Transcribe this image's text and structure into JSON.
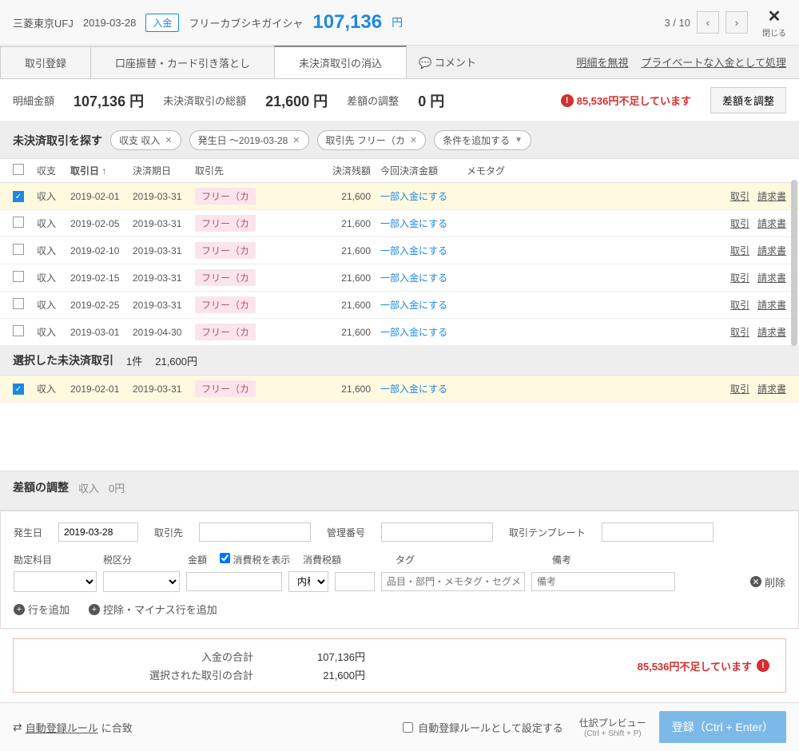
{
  "header": {
    "bank": "三菱東京UFJ",
    "date": "2019-03-28",
    "deposit_badge": "入金",
    "payer": "フリーカブシキガイシャ",
    "amount": "107,136",
    "yen": "円",
    "page": "3 / 10",
    "close": "閉じる"
  },
  "tabs": {
    "register": "取引登録",
    "transfer": "口座振替・カード引き落とし",
    "unsettled": "未決済取引の消込",
    "comment": "コメント"
  },
  "header_links": {
    "ignore": "明細を無視",
    "private": "プライベートな入金として処理"
  },
  "summary": {
    "detail_label": "明細金額",
    "detail_value": "107,136 円",
    "unsettled_label": "未決済取引の総額",
    "unsettled_value": "21,600 円",
    "diff_label": "差額の調整",
    "diff_value": "0 円",
    "shortage": "85,536円不足しています",
    "adjust_btn": "差額を調整"
  },
  "filters": {
    "title": "未決済取引を探す",
    "chip1": "収支 収入",
    "chip2": "発生日 ～2019-03-28",
    "chip3": "取引先 フリー（カ",
    "add": "条件を追加する"
  },
  "columns": {
    "type": "収支",
    "date": "取引日 ↑",
    "due": "決済期日",
    "vendor": "取引先",
    "balance": "決済残額",
    "settle": "今回決済金額",
    "memo": "メモタグ"
  },
  "rows": [
    {
      "type": "収入",
      "date": "2019-02-01",
      "due": "2019-03-31",
      "vendor": "フリー（カ",
      "balance": "21,600",
      "checked": true
    },
    {
      "type": "収入",
      "date": "2019-02-05",
      "due": "2019-03-31",
      "vendor": "フリー（カ",
      "balance": "21,600",
      "checked": false
    },
    {
      "type": "収入",
      "date": "2019-02-10",
      "due": "2019-03-31",
      "vendor": "フリー（カ",
      "balance": "21,600",
      "checked": false
    },
    {
      "type": "収入",
      "date": "2019-02-15",
      "due": "2019-03-31",
      "vendor": "フリー（カ",
      "balance": "21,600",
      "checked": false
    },
    {
      "type": "収入",
      "date": "2019-02-25",
      "due": "2019-03-31",
      "vendor": "フリー（カ",
      "balance": "21,600",
      "checked": false
    },
    {
      "type": "収入",
      "date": "2019-03-01",
      "due": "2019-04-30",
      "vendor": "フリー（カ",
      "balance": "21,600",
      "checked": false
    }
  ],
  "row_actions": {
    "partial": "一部入金にする",
    "txn": "取引",
    "invoice": "請求書"
  },
  "selected": {
    "title": "選択した未決済取引",
    "count": "1件",
    "amount": "21,600円"
  },
  "selected_row": {
    "type": "収入",
    "date": "2019-02-01",
    "due": "2019-03-31",
    "vendor": "フリー（カ",
    "balance": "21,600"
  },
  "adjust": {
    "title": "差額の調整",
    "type": "収入",
    "zero": "0円",
    "occur_date_label": "発生日",
    "occur_date": "2019-03-28",
    "vendor_label": "取引先",
    "mgmt_label": "管理番号",
    "template_label": "取引テンプレート",
    "account_label": "勘定科目",
    "tax_type_label": "税区分",
    "amount_label": "金額",
    "show_tax": "消費税を表示",
    "tax_amount_label": "消費税額",
    "tag_label": "タグ",
    "note_label": "備考",
    "tax_option": "内税",
    "tag_placeholder": "品目・部門・メモタグ・セグメント",
    "note_placeholder": "備考",
    "delete": "削除",
    "add_row": "行を追加",
    "add_deduction": "控除・マイナス行を追加"
  },
  "totals": {
    "deposit_label": "入金の合計",
    "deposit_value": "107,136円",
    "selected_label": "選択された取引の合計",
    "selected_value": "21,600円",
    "warning": "85,536円不足しています"
  },
  "footer": {
    "auto_rule_prefix": "自動登録ルール",
    "auto_rule_suffix": "に合致",
    "set_as_rule": "自動登録ルールとして設定する",
    "preview": "仕訳プレビュー",
    "preview_shortcut": "(Ctrl + Shift + P)",
    "register": "登録（Ctrl + Enter）"
  }
}
